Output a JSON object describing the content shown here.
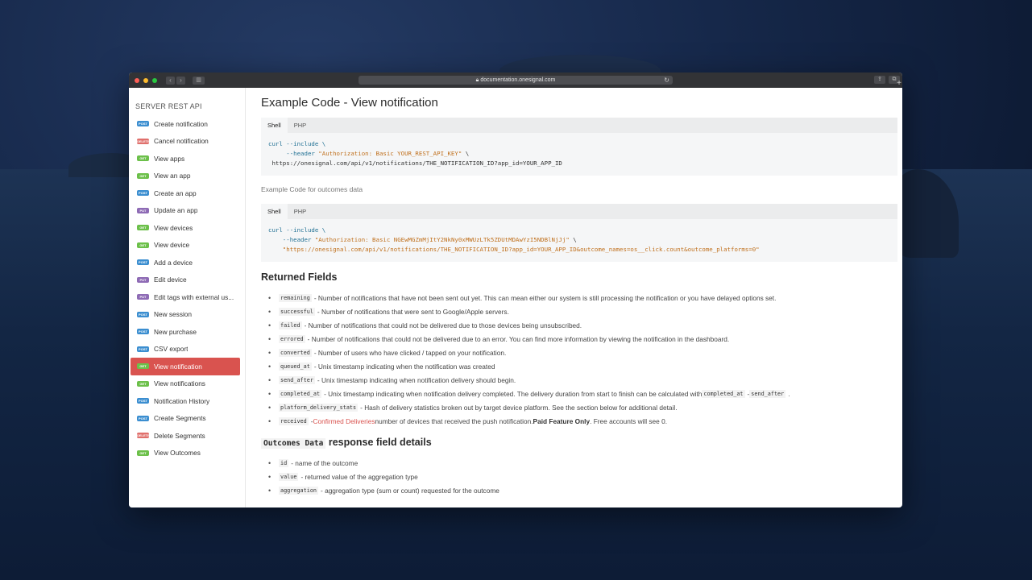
{
  "browser": {
    "url": "documentation.onesignal.com",
    "traffic_lights": [
      "#fe5f57",
      "#febc2e",
      "#28c840"
    ]
  },
  "sidebar": {
    "title": "SERVER REST API",
    "items": [
      {
        "badge": "POST",
        "label": "Create notification"
      },
      {
        "badge": "DELETE",
        "label": "Cancel notification"
      },
      {
        "badge": "GET",
        "label": "View apps"
      },
      {
        "badge": "GET",
        "label": "View an app"
      },
      {
        "badge": "POST",
        "label": "Create an app"
      },
      {
        "badge": "PUT",
        "label": "Update an app"
      },
      {
        "badge": "GET",
        "label": "View devices"
      },
      {
        "badge": "GET",
        "label": "View device"
      },
      {
        "badge": "POST",
        "label": "Add a device"
      },
      {
        "badge": "PUT",
        "label": "Edit device"
      },
      {
        "badge": "PUT",
        "label": "Edit tags with external us..."
      },
      {
        "badge": "POST",
        "label": "New session"
      },
      {
        "badge": "POST",
        "label": "New purchase"
      },
      {
        "badge": "POST",
        "label": "CSV export"
      },
      {
        "badge": "GET",
        "label": "View notification",
        "active": true
      },
      {
        "badge": "GET",
        "label": "View notifications"
      },
      {
        "badge": "POST",
        "label": "Notification History"
      },
      {
        "badge": "POST",
        "label": "Create Segments"
      },
      {
        "badge": "DELETE",
        "label": "Delete Segments"
      },
      {
        "badge": "GET",
        "label": "View Outcomes"
      }
    ],
    "badge_colors": {
      "POST": "#3b8ed0",
      "DELETE": "#e0706c",
      "GET": "#6cc04a",
      "PUT": "#8e6bb5"
    }
  },
  "main": {
    "title": "Example Code - View notification",
    "code1": {
      "tabs": [
        "Shell",
        "PHP"
      ],
      "line1_cmd": "curl --include \\",
      "line2_flag": "     --header ",
      "line2_str": "\"Authorization: Basic YOUR_REST_API_KEY\"",
      "line2_end": " \\",
      "line3": " https://onesignal.com/api/v1/notifications/THE_NOTIFICATION_ID?app_id=YOUR_APP_ID"
    },
    "caption": "Example Code for outcomes data",
    "code2": {
      "tabs": [
        "Shell",
        "PHP"
      ],
      "line1_cmd": "curl --include \\",
      "line2_flag": "    --header ",
      "line2_str": "\"Authorization: Basic NGEwMGZmMjItY2NkNy0xMWUzLTk5ZDUtMDAwYzI5NDBlNjJj\"",
      "line2_end": " \\",
      "line3_str": "    \"https://onesignal.com/api/v1/notifications/THE_NOTIFICATION_ID?app_id=YOUR_APP_ID&outcome_names=os__click.count&outcome_platforms=0\""
    },
    "returned_heading": "Returned Fields",
    "fields": [
      {
        "code": "remaining",
        "text": " - Number of notifications that have not been sent out yet. This can mean either our system is still processing the notification or you have delayed options set."
      },
      {
        "code": "successful",
        "text": " - Number of notifications that were sent to Google/Apple servers."
      },
      {
        "code": "failed",
        "text": " - Number of notifications that could not be delivered due to those devices being unsubscribed."
      },
      {
        "code": "errored",
        "text": " - Number of notifications that could not be delivered due to an error. You can find more information by viewing the notification in the dashboard."
      },
      {
        "code": "converted",
        "text": " - Number of users who have clicked / tapped on your notification."
      },
      {
        "code": "queued_at",
        "text": " - Unix timestamp indicating when the notification was created"
      },
      {
        "code": "send_after",
        "text": " - Unix timestamp indicating when notification delivery should begin."
      }
    ],
    "completed": {
      "code": "completed_at",
      "text": " - Unix timestamp indicating when notification delivery completed. The delivery duration from start to finish can be calculated with ",
      "code2": "completed_at",
      "sep": " - ",
      "code3": "send_after",
      "end": "."
    },
    "platform": {
      "code": "platform_delivery_stats",
      "text": " - Hash of delivery statistics broken out by target device platform. See the section below for additional detail."
    },
    "received": {
      "code": "received",
      "dash": " - ",
      "link": "Confirmed Deliveries",
      "text": " number of devices that received the push notification. ",
      "bold": "Paid Feature Only",
      "end": ". Free accounts will see 0."
    },
    "outcomes_heading_code": "Outcomes Data",
    "outcomes_heading_text": " response field details",
    "outcomes": [
      {
        "code": "id",
        "text": " - name of the outcome"
      },
      {
        "code": "value",
        "text": " - returned value of the aggregation type"
      },
      {
        "code": "aggregation",
        "text": " - aggregation type (sum or count) requested for the outcome"
      }
    ]
  }
}
